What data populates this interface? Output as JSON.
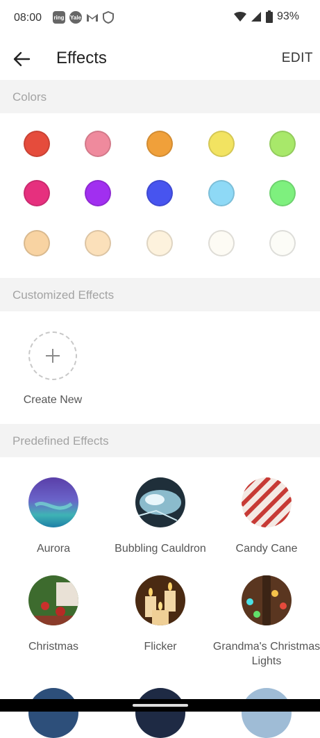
{
  "status_bar": {
    "time": "08:00",
    "apps": [
      "ring",
      "Yale",
      "M",
      "shield"
    ],
    "battery": "93%"
  },
  "app_bar": {
    "title": "Effects",
    "edit_label": "EDIT",
    "back_icon": "arrow-left-icon"
  },
  "colors_section": {
    "header": "Colors",
    "swatches": [
      "#e54c3c",
      "#ef8a9d",
      "#f0a03a",
      "#f2e361",
      "#a8e86a",
      "#e6307e",
      "#a12ff0",
      "#4754ef",
      "#8ed9f6",
      "#7ef07e",
      "#f8d3a2",
      "#fbe0ba",
      "#fdf2dd",
      "#fdfbf4",
      "#fcfcf7"
    ]
  },
  "custom_section": {
    "header": "Customized Effects",
    "create_label": "Create New",
    "create_icon": "plus-icon"
  },
  "predefined_section": {
    "header": "Predefined Effects",
    "effects": [
      {
        "label": "Aurora"
      },
      {
        "label": "Bubbling Cauldron"
      },
      {
        "label": "Candy Cane"
      },
      {
        "label": "Christmas"
      },
      {
        "label": "Flicker"
      },
      {
        "label": "Grandma's Christmas Lights"
      }
    ]
  }
}
